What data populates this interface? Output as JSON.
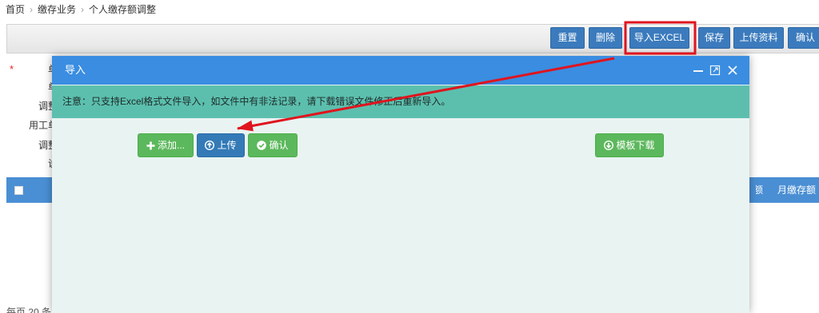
{
  "breadcrumb": {
    "items": [
      "首页",
      "缴存业务",
      "个人缴存额调整"
    ],
    "separator": "›"
  },
  "toolbar": {
    "buttons": [
      "重置",
      "删除",
      "导入EXCEL",
      "保存",
      "上传资料",
      "确认"
    ]
  },
  "form": {
    "required_mark": "*",
    "labels": [
      "单",
      "单",
      "调整",
      "用工单",
      "调整",
      "说"
    ]
  },
  "table": {
    "columns": [
      "额",
      "月缴存额"
    ]
  },
  "pager": {
    "page_size_text": "每页 20 条"
  },
  "dialog": {
    "title": "导入",
    "notice": "注意：只支持Excel格式文件导入，如文件中有非法记录，请下载错误文件修正后重新导入。",
    "buttons": {
      "add": {
        "label": "添加...",
        "icon": "plus-icon"
      },
      "upload": {
        "label": "上传",
        "icon": "circle-arrow-up-icon"
      },
      "confirm": {
        "label": "确认",
        "icon": "check-circle-icon"
      },
      "template_download": {
        "label": "模板下载",
        "icon": "circle-arrow-down-icon"
      }
    },
    "window_controls": [
      "minimize-icon",
      "maximize-icon",
      "close-icon"
    ]
  },
  "colors": {
    "toolbar_button": "#3b7bbd",
    "table_header": "#4a8fd4",
    "dialog_header": "#3a8de1",
    "dialog_body": "#e9f4f2",
    "notice": "#5cbfae",
    "success_button": "#5cb85c",
    "primary_button": "#337ab7",
    "annotation": "#e0141e"
  }
}
